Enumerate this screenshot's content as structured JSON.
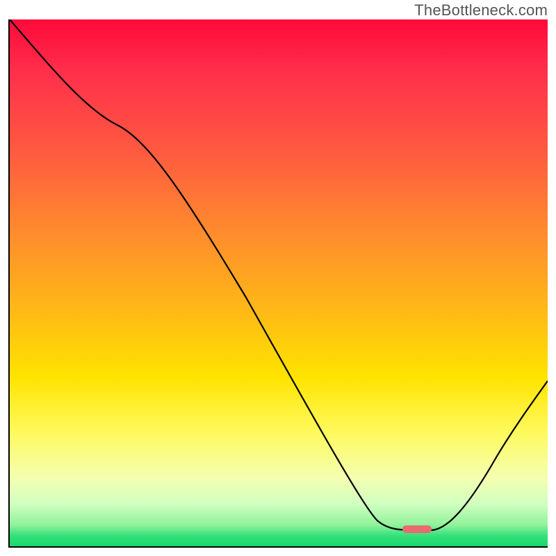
{
  "watermark": "TheBottleneck.com",
  "chart_data": {
    "type": "line",
    "title": "",
    "xlabel": "",
    "ylabel": "",
    "xlim": [
      0,
      100
    ],
    "ylim": [
      0,
      100
    ],
    "x": [
      0,
      20,
      68,
      76,
      78,
      100
    ],
    "values": [
      100,
      80,
      5,
      3,
      3,
      28
    ],
    "marker": {
      "x_start": 73,
      "x_end": 79,
      "y": 3
    },
    "gradient_stops": [
      {
        "pos": 0,
        "color": "#ff0a3a"
      },
      {
        "pos": 25,
        "color": "#ff5a40"
      },
      {
        "pos": 55,
        "color": "#ffb817"
      },
      {
        "pos": 78,
        "color": "#fff95a"
      },
      {
        "pos": 96,
        "color": "#8ff29a"
      },
      {
        "pos": 100,
        "color": "#17d96e"
      }
    ]
  }
}
